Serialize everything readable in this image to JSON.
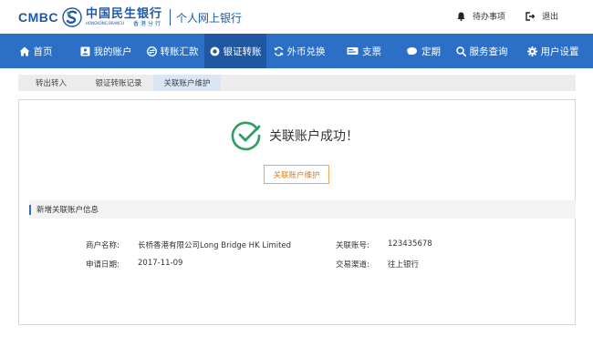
{
  "header": {
    "logo_en": "CMBC",
    "logo_cn": "中国民生银行",
    "logo_sub_en": "HONGKONG BRANCH",
    "logo_sub_cn": "香港分行",
    "portal_title": "个人网上银行",
    "todo_label": "待办事项",
    "logout_label": "退出"
  },
  "nav": {
    "items": [
      {
        "label": "首页",
        "icon": "home-icon"
      },
      {
        "label": "我的账户",
        "icon": "account-icon"
      },
      {
        "label": "转账汇款",
        "icon": "transfer-icon"
      },
      {
        "label": "银证转账",
        "icon": "securities-icon"
      },
      {
        "label": "外币兑换",
        "icon": "exchange-icon"
      },
      {
        "label": "支票",
        "icon": "cheque-icon"
      },
      {
        "label": "定期",
        "icon": "deposit-icon"
      },
      {
        "label": "服务查询",
        "icon": "search-icon"
      },
      {
        "label": "用户设置",
        "icon": "gear-icon"
      }
    ],
    "active_index": 3
  },
  "subnav": {
    "tabs": [
      "转出转入",
      "银证转账记录",
      "关联账户维护"
    ],
    "active_index": 2
  },
  "result": {
    "title": "关联账户成功！",
    "button_label": "关联账户维护"
  },
  "section": {
    "title": "新增关联账户信息"
  },
  "info": {
    "merchant_label": "商户名称:",
    "merchant_value": "长桥香港有限公司Long Bridge HK Limited",
    "date_label": "申请日期:",
    "date_value": "2017-11-09",
    "account_label": "关联账号:",
    "account_value": "123435678",
    "channel_label": "交易渠道:",
    "channel_value": "往上银行"
  },
  "colors": {
    "brand_blue": "#2b6fc7",
    "nav_active": "#1f57a3",
    "success_green": "#2f9e63",
    "button_orange": "#f0a552"
  }
}
